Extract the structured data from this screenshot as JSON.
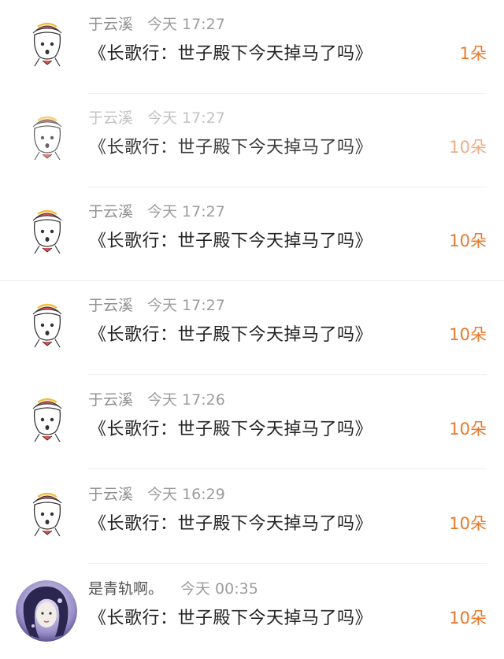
{
  "messages": [
    {
      "name": "于云溪",
      "time": "今天 17:27",
      "text": "《长歌行：世子殿下今天掉马了吗》",
      "gift": "1朵",
      "avatar": "cartoon-girl-avatar"
    },
    {
      "name": "于云溪",
      "time": "今天 17:27",
      "text": "《长歌行：世子殿下今天掉马了吗》",
      "gift": "10朵",
      "avatar": "cartoon-girl-avatar"
    },
    {
      "name": "于云溪",
      "time": "今天 17:27",
      "text": "《长歌行：世子殿下今天掉马了吗》",
      "gift": "10朵",
      "avatar": "cartoon-girl-avatar"
    },
    {
      "name": "于云溪",
      "time": "今天 17:27",
      "text": "《长歌行：世子殿下今天掉马了吗》",
      "gift": "10朵",
      "avatar": "cartoon-girl-avatar"
    },
    {
      "name": "于云溪",
      "time": "今天 17:26",
      "text": "《长歌行：世子殿下今天掉马了吗》",
      "gift": "10朵",
      "avatar": "cartoon-girl-avatar"
    },
    {
      "name": "于云溪",
      "time": "今天 16:29",
      "text": "《长歌行：世子殿下今天掉马了吗》",
      "gift": "10朵",
      "avatar": "cartoon-girl-avatar"
    },
    {
      "name": "是青轨啊。",
      "time": "今天 00:35",
      "text": "《长歌行：世子殿下今天掉马了吗》",
      "gift": "10朵",
      "avatar": "illustrated-portrait-avatar"
    }
  ],
  "colors": {
    "gift": "#e8792b",
    "name": "#8f8f8f",
    "text": "#222222"
  }
}
